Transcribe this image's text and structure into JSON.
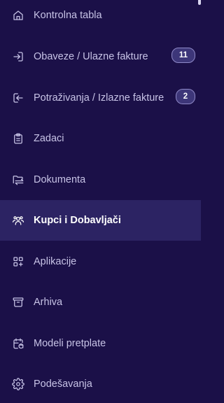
{
  "sidebar": {
    "items": [
      {
        "label": "Kontrolna tabla",
        "icon": "home-icon",
        "active": false
      },
      {
        "label": "Obaveze / Ulazne fakture",
        "icon": "login-arrow-icon",
        "badge": "11",
        "active": false
      },
      {
        "label": "Potraživanja / Izlazne fakture",
        "icon": "logout-arrow-icon",
        "badge": "2",
        "active": false
      },
      {
        "label": "Zadaci",
        "icon": "clipboard-icon",
        "active": false
      },
      {
        "label": "Dokumenta",
        "icon": "folder-transfer-icon",
        "active": false
      },
      {
        "label": "Kupci i Dobavljači",
        "icon": "users-icon",
        "active": true
      },
      {
        "label": "Aplikacije",
        "icon": "apps-icon",
        "active": false
      },
      {
        "label": "Arhiva",
        "icon": "archive-icon",
        "active": false
      },
      {
        "label": "Modeli pretplate",
        "icon": "calendar-refresh-icon",
        "active": false
      },
      {
        "label": "Podešavanja",
        "icon": "gear-icon",
        "active": false
      }
    ]
  },
  "colors": {
    "background": "#1b1048",
    "active_background": "#2c2363",
    "text": "#c7c3e6",
    "active_text": "#ffffff",
    "badge_background": "#3d3679",
    "badge_border": "#8f89c7"
  }
}
